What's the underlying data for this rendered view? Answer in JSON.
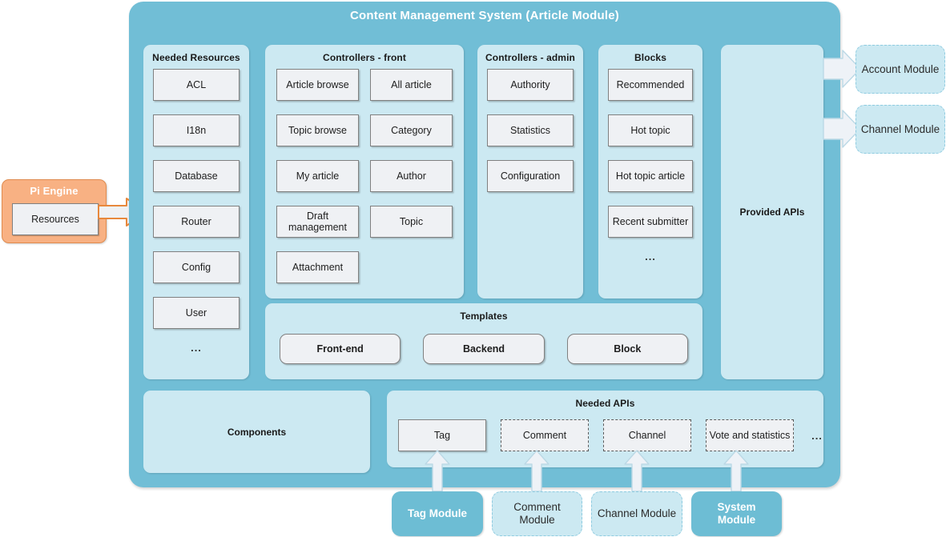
{
  "diagram": {
    "title": "Content Management System (Article Module)",
    "colors": {
      "teal": "#71bed6",
      "panel_blue": "#cce9f2",
      "box_grey": "#eff1f4",
      "orange": "#f8b183",
      "module_teal": "#6dbdd4"
    }
  },
  "pi_engine": {
    "title": "Pi Engine",
    "resources_label": "Resources"
  },
  "needed_resources": {
    "title": "Needed Resources",
    "items": [
      "ACL",
      "I18n",
      "Database",
      "Router",
      "Config",
      "User"
    ],
    "ellipsis": "..."
  },
  "controllers_front": {
    "title": "Controllers - front",
    "items": [
      "Article browse",
      "All article",
      "Topic browse",
      "Category",
      "My article",
      "Author",
      "Draft management",
      "Topic",
      "Attachment"
    ]
  },
  "controllers_admin": {
    "title": "Controllers - admin",
    "items": [
      "Authority",
      "Statistics",
      "Configuration"
    ]
  },
  "blocks": {
    "title": "Blocks",
    "items": [
      "Recommended",
      "Hot topic",
      "Hot topic article",
      "Recent submitter"
    ],
    "ellipsis": "..."
  },
  "provided_apis": {
    "title": "Provided APIs"
  },
  "templates": {
    "title": "Templates",
    "items": [
      "Front-end",
      "Backend",
      "Block"
    ]
  },
  "components": {
    "title": "Components"
  },
  "needed_apis": {
    "title": "Needed APIs",
    "items": [
      {
        "label": "Tag",
        "style": "solid"
      },
      {
        "label": "Comment",
        "style": "dashed"
      },
      {
        "label": "Channel",
        "style": "dashed"
      },
      {
        "label": "Vote and statistics",
        "style": "dashed"
      }
    ],
    "ellipsis": "..."
  },
  "external_modules": [
    {
      "label": "Account Module",
      "line1": "Account",
      "line2": "Module"
    },
    {
      "label": "Channel Module",
      "line1": "Channel Module",
      "line2": ""
    }
  ],
  "bottom_modules": [
    {
      "line1": "Tag Module",
      "line2": "",
      "style": "solid"
    },
    {
      "line1": "Comment",
      "line2": "Module",
      "style": "dashed"
    },
    {
      "line1": "Channel Module",
      "line2": "",
      "style": "dashed"
    },
    {
      "line1": "System",
      "line2": "Module",
      "style": "solid"
    }
  ]
}
